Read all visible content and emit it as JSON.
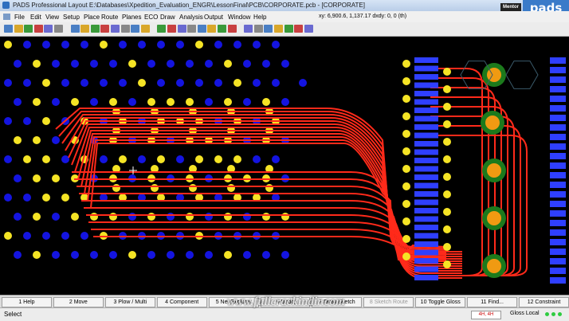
{
  "window": {
    "title": "PADS Professional Layout  E:\\Databases\\Xpedition_Evaluation_ENGR\\LessonFinal\\PCB\\CORPORATE.pcb - [CORPORATE]",
    "brand_logo": "pads",
    "vendor_logo": "Mentor"
  },
  "menu": {
    "items": [
      "File",
      "Edit",
      "View",
      "Setup",
      "Place",
      "Route",
      "Planes",
      "ECO",
      "Draw",
      "Analysis",
      "Output",
      "Window",
      "Help"
    ],
    "coords": "xy: 6,900.6, 1,137.17   dxdy: 0, 0  (th)"
  },
  "toolbar": {
    "buttons": [
      "new-icon",
      "open-icon",
      "save-icon",
      "undo-icon",
      "redo-icon",
      "properties-icon",
      "pointer-icon",
      "select-icon",
      "place-icon",
      "route-icon",
      "fanout-icon",
      "plane-icon",
      "eco-icon",
      "draw-icon",
      "zoom-icon",
      "zoom-fit-icon",
      "view-icon",
      "layer-icon",
      "display-icon",
      "grid-icon",
      "drc-icon",
      "check-icon",
      "measure-icon",
      "highlight-icon",
      "color-icon",
      "filter-icon",
      "snap-icon",
      "net-icon",
      "part-icon"
    ]
  },
  "fkeys": [
    {
      "label": "1 Help",
      "enabled": true
    },
    {
      "label": "2 Move",
      "enabled": true
    },
    {
      "label": "3 Plow / Multi",
      "enabled": true
    },
    {
      "label": "4 Component",
      "enabled": true
    },
    {
      "label": "5 Net Explorer",
      "enabled": true
    },
    {
      "label": "6 Undo",
      "enabled": true
    },
    {
      "label": "7 Draw Sketch",
      "enabled": true
    },
    {
      "label": "8 Sketch Route",
      "enabled": false
    },
    {
      "label": "10 Toggle Gloss",
      "enabled": true
    },
    {
      "label": "11 Find...",
      "enabled": true
    },
    {
      "label": "12 Constraint",
      "enabled": true
    }
  ],
  "status": {
    "mode": "Select",
    "box_text": "4H, 4H",
    "gloss": "Gloss Local"
  },
  "watermark": "www.fullcrackindir.com",
  "colors": {
    "background": "#000000",
    "pad_yellow": "#f5e425",
    "via_blue": "#1414e0",
    "trace_red": "#ff2a1a",
    "smd_pad_blue": "#2f3fff",
    "mount_green": "#1c7a1c",
    "mount_orange": "#f09a12"
  }
}
